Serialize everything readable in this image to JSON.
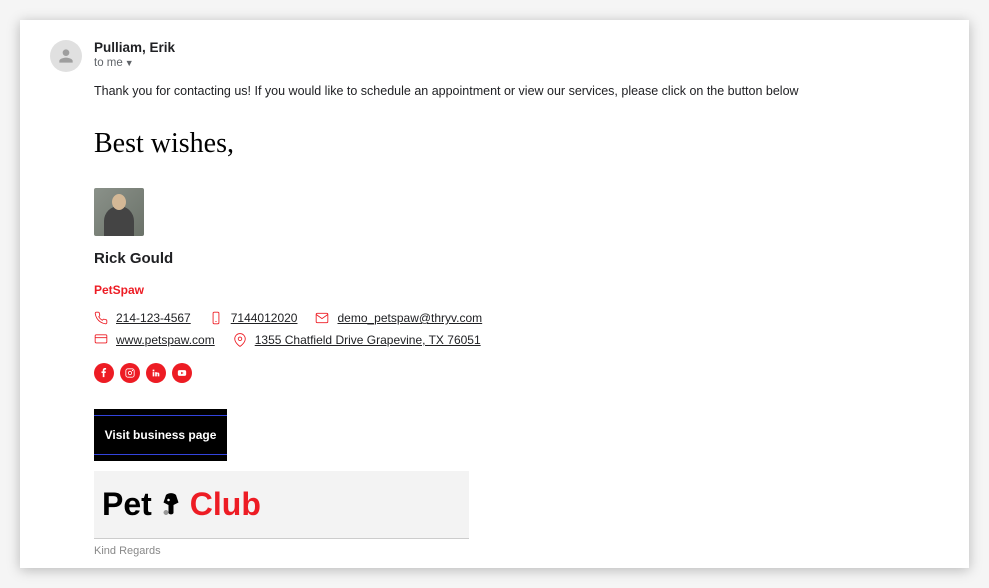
{
  "header": {
    "sender_name": "Pulliam, Erik",
    "recipient_label": "to me"
  },
  "body": {
    "text": "Thank you for contacting us! If you would like to schedule an appointment or view our services, please click on the button below"
  },
  "signature": {
    "greeting": "Best wishes,",
    "name": "Rick Gould",
    "company": "PetSpaw",
    "phone": "214-123-4567",
    "mobile": "7144012020",
    "email": "demo_petspaw@thryv.com",
    "website": "www.petspaw.com",
    "address": "1355 Chatfield Drive Grapevine, TX 76051",
    "visit_button": "Visit business page",
    "logo_part1": "Pet",
    "logo_part2": "Club",
    "closing": "Kind Regards"
  },
  "social": {
    "facebook": "facebook",
    "instagram": "instagram",
    "linkedin": "linkedin",
    "youtube": "youtube"
  }
}
